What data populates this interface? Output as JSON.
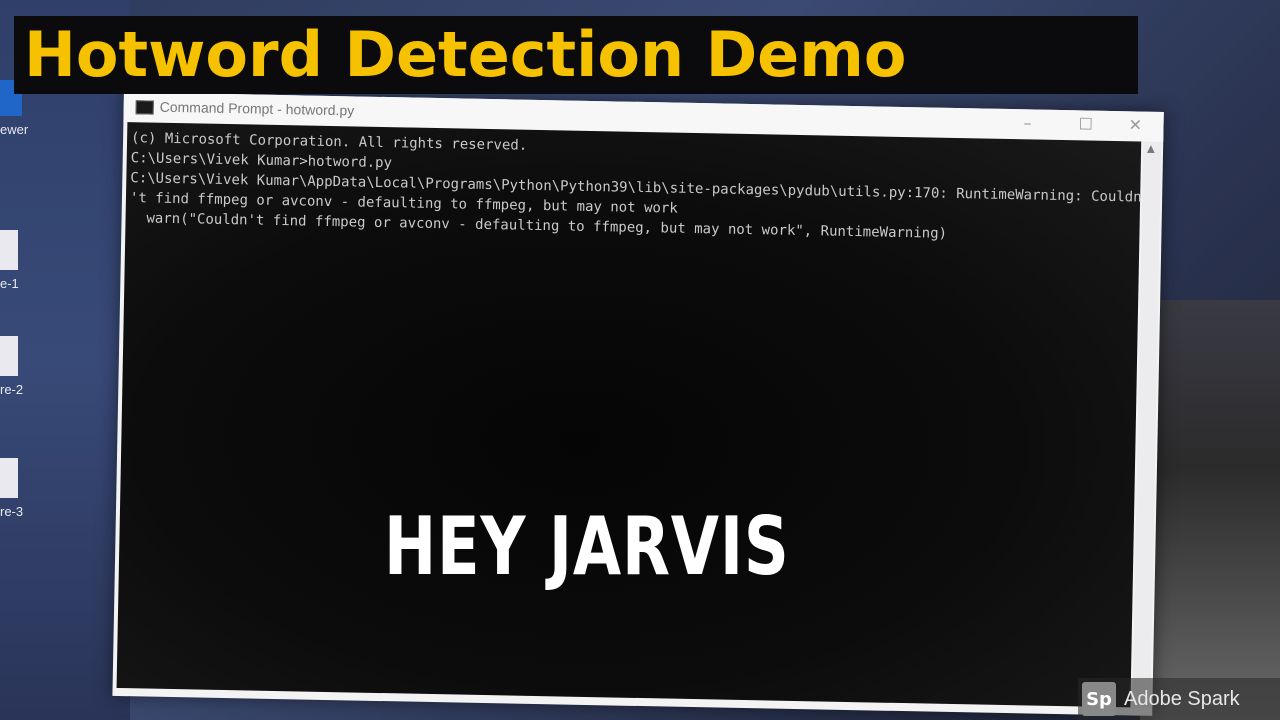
{
  "banner": {
    "title": "Hotword Detection Demo"
  },
  "desktop": {
    "icons": [
      {
        "label": "ewer",
        "icon": "app-icon"
      },
      {
        "label": "e-1",
        "icon": "file-icon"
      },
      {
        "label": "re-2",
        "icon": "file-icon"
      },
      {
        "label": "re-3",
        "icon": "file-icon"
      }
    ]
  },
  "window": {
    "title": "Command Prompt - hotword.py",
    "controls": {
      "minimize": "–",
      "maximize": "☐",
      "close": "✕"
    },
    "console_lines": [
      "(c) Microsoft Corporation. All rights reserved.",
      "",
      "C:\\Users\\Vivek Kumar>hotword.py",
      "C:\\Users\\Vivek Kumar\\AppData\\Local\\Programs\\Python\\Python39\\lib\\site-packages\\pydub\\utils.py:170: RuntimeWarning: Couldn",
      "'t find ffmpeg or avconv - defaulting to ffmpeg, but may not work",
      "  warn(\"Couldn't find ffmpeg or avconv - defaulting to ffmpeg, but may not work\", RuntimeWarning)"
    ]
  },
  "overlay": {
    "caption": "HEY JARVIS"
  },
  "watermark": {
    "logo": "Sp",
    "brand": "Adobe Spark"
  }
}
